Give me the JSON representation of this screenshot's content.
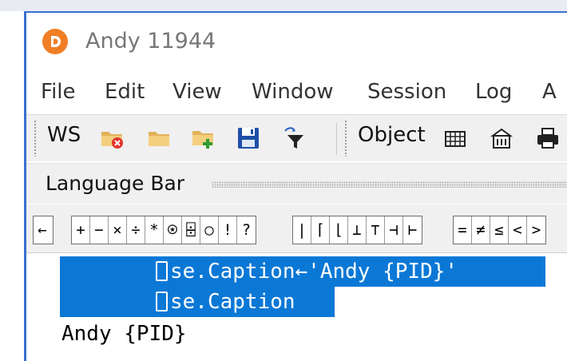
{
  "window": {
    "title": "Andy 11944"
  },
  "menu": {
    "items": [
      "File",
      "Edit",
      "View",
      "Window",
      "Session",
      "Log",
      "A"
    ]
  },
  "toolbar": {
    "ws_label": "WS",
    "object_label": "Object",
    "ws_icons": [
      "folder-clear-icon",
      "folder-open-icon",
      "folder-add-icon",
      "save-icon",
      "filter-icon"
    ],
    "object_icons": [
      "grid-icon",
      "namespace-icon",
      "print-icon"
    ]
  },
  "language_bar": {
    "label": "Language Bar",
    "groups": [
      [
        "←"
      ],
      [
        "+",
        "−",
        "×",
        "÷",
        "*",
        "⍟",
        "⌹",
        "○",
        "!",
        "?"
      ],
      [
        "|",
        "⌈",
        "⌊",
        "⊥",
        "⊤",
        "⊣",
        "⊢"
      ],
      [
        "=",
        "≠",
        "≤",
        "<",
        ">"
      ]
    ]
  },
  "session": {
    "lines": [
      {
        "text": "se.Caption←'Andy {PID}'",
        "quad": true,
        "selected": true
      },
      {
        "text": "se.Caption",
        "quad": true,
        "selected": true
      },
      {
        "text": "Andy {PID}",
        "quad": false,
        "selected": false
      }
    ]
  },
  "colors": {
    "selection": "#0b78d6",
    "app_icon": "#f07e26",
    "window_border": "#3a6fd0"
  }
}
